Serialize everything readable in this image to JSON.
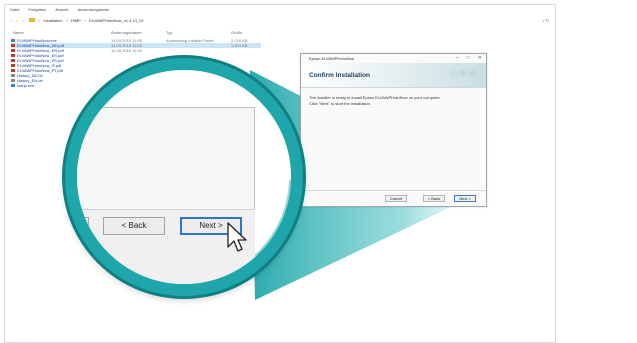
{
  "explorer": {
    "menu": [
      "Datei",
      "Freigeben",
      "Ansicht",
      "Anwendungstools"
    ],
    "address": {
      "crumbs": [
        "Installation",
        "HIMP",
        "ELVAWPHotoNow_v1.4.14_02"
      ],
      "separator": ">",
      "controls": "v  ↻"
    },
    "columns": {
      "name": "Name",
      "date": "Änderungsdatum",
      "type": "Typ",
      "size": "Größe"
    },
    "files": [
      {
        "name": "ELVAWPHotoNow.exe",
        "date": "14.03.2018 11:05",
        "type": "Anwendung Installer Paket",
        "size": "2.076 KB",
        "icon_color": "#4a78b8",
        "selected": false
      },
      {
        "name": "ELVAWPHotoNow_DE.pdf",
        "date": "14.03.2018 11:05",
        "type": "",
        "size": "1.404 KB",
        "icon_color": "#c0392b",
        "selected": true
      },
      {
        "name": "ELVAWPHotoNow_EN.pdf",
        "date": "14.03.2018 11:05",
        "type": "",
        "size": "",
        "icon_color": "#c0392b",
        "selected": false
      },
      {
        "name": "ELVAWPHotoNow_ES.pdf",
        "date": "",
        "type": "",
        "size": "",
        "icon_color": "#c0392b",
        "selected": false
      },
      {
        "name": "ELVAWPHotoNow_FR.pdf",
        "date": "",
        "type": "",
        "size": "",
        "icon_color": "#c0392b",
        "selected": false
      },
      {
        "name": "ELVAWPHotoNow_IT.pdf",
        "date": "",
        "type": "",
        "size": "",
        "icon_color": "#c0392b",
        "selected": false
      },
      {
        "name": "ELVAWPHotoNow_PT.pdf",
        "date": "",
        "type": "",
        "size": "",
        "icon_color": "#c0392b",
        "selected": false
      },
      {
        "name": "History_DE.txt",
        "date": "",
        "type": "",
        "size": "",
        "icon_color": "#8a8a8a",
        "selected": false
      },
      {
        "name": "History_EN.txt",
        "date": "",
        "type": "",
        "size": "",
        "icon_color": "#8a8a8a",
        "selected": false
      },
      {
        "name": "setup.exe",
        "date": "",
        "type": "",
        "size": "",
        "icon_color": "#3d7bd6",
        "selected": false
      }
    ]
  },
  "dialog": {
    "title": "Epson ELVAWPHotoNow",
    "controls": [
      "–",
      "□",
      "✕"
    ],
    "header_title": "Confirm Installation",
    "header_logo": "◎⊕◎",
    "body_line1": "The installer is ready to install Epson ELVAWPHotoNow on your computer.",
    "body_line2": "Click \"Next\" to start the installation.",
    "buttons": {
      "cancel": "Cancel",
      "back": "< Back",
      "next": "Next >"
    }
  },
  "magnifier": {
    "back_label": "< Back",
    "next_label": "Next >"
  },
  "colors": {
    "teal": "#1fa6aa",
    "teal_dark": "#117f83",
    "focus_blue": "#2f74d0"
  }
}
